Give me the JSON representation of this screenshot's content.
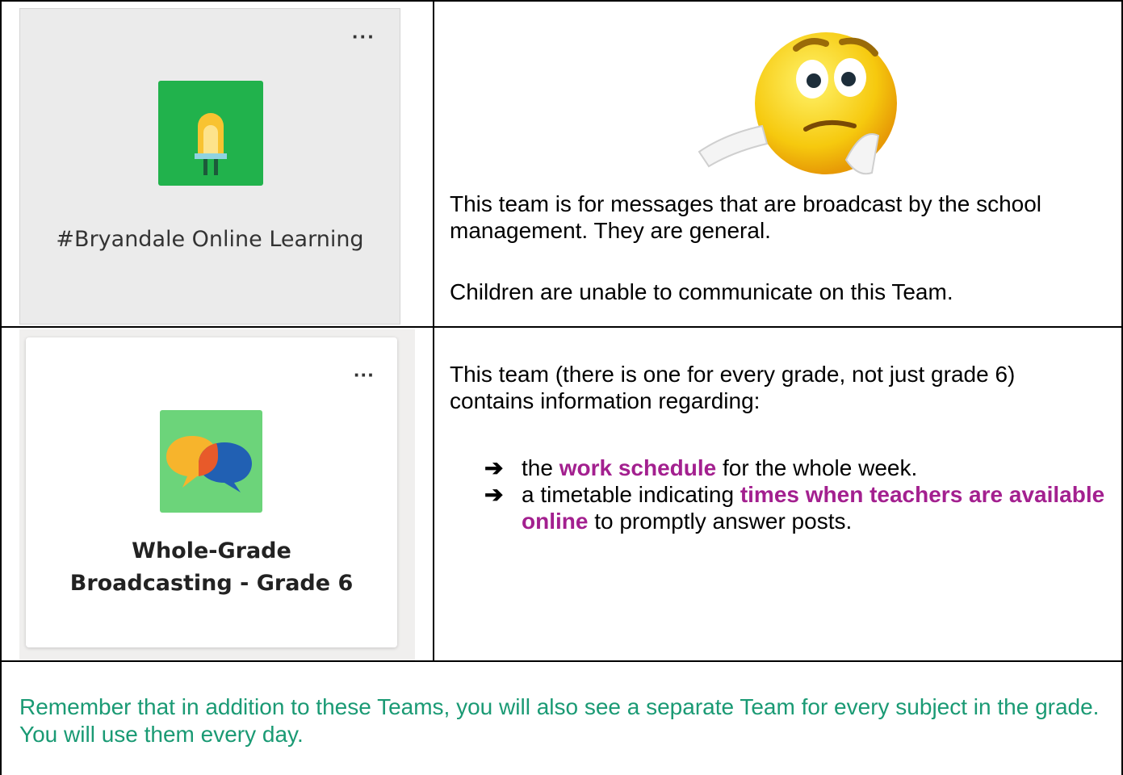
{
  "teams": [
    {
      "menu_icon": "more-options-icon",
      "icon": "led-bulb-icon",
      "icon_bg": "#21b24c",
      "name": "#Bryandale Online Learning",
      "description": [
        "This team is for messages that are broadcast by the school management.  They are general.",
        "Children are unable to communicate on this Team."
      ]
    },
    {
      "menu_icon": "more-options-icon",
      "icon": "speech-bubbles-icon",
      "icon_bg": "#6cd47a",
      "name_line1": "Whole-Grade",
      "name_line2": "Broadcasting - Grade 6",
      "intro": "This team (there is one for every grade, not just grade 6) contains information regarding:",
      "bullets": [
        {
          "pre": "the ",
          "highlight": "work schedule",
          "post": " for the whole week."
        },
        {
          "pre": "a timetable indicating ",
          "highlight": "times when teachers are available online",
          "post": " to promptly answer posts."
        }
      ]
    }
  ],
  "emoji": "thinking-face-icon",
  "footer": "Remember that in addition to these Teams, you will also see a separate Team for every subject in the grade.  You will use them every day.",
  "colors": {
    "highlight": "#a3208f",
    "footer": "#1a9a74"
  }
}
